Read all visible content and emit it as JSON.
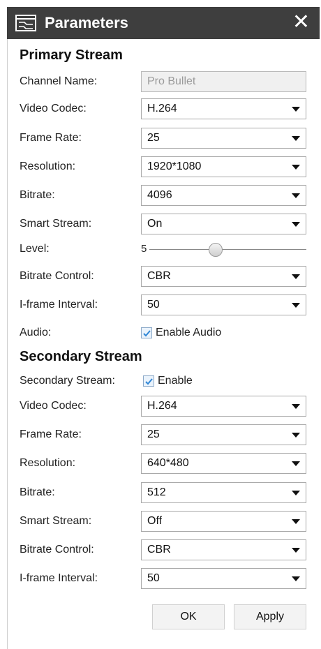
{
  "window": {
    "title": "Parameters"
  },
  "primary": {
    "section_title": "Primary Stream",
    "channel_name": {
      "label": "Channel Name:",
      "value": "Pro Bullet"
    },
    "video_codec": {
      "label": "Video Codec:",
      "value": "H.264"
    },
    "frame_rate": {
      "label": "Frame Rate:",
      "value": "25"
    },
    "resolution": {
      "label": "Resolution:",
      "value": "1920*1080"
    },
    "bitrate": {
      "label": "Bitrate:",
      "value": "4096"
    },
    "smart_stream": {
      "label": "Smart Stream:",
      "value": "On"
    },
    "level": {
      "label": "Level:",
      "value": "5"
    },
    "bitrate_control": {
      "label": "Bitrate Control:",
      "value": "CBR"
    },
    "iframe_interval": {
      "label": "I-frame Interval:",
      "value": "50"
    },
    "audio": {
      "label": "Audio:",
      "checkbox_label": "Enable Audio"
    }
  },
  "secondary": {
    "section_title": "Secondary Stream",
    "enable": {
      "label": "Secondary Stream:",
      "checkbox_label": "Enable"
    },
    "video_codec": {
      "label": "Video Codec:",
      "value": "H.264"
    },
    "frame_rate": {
      "label": "Frame Rate:",
      "value": "25"
    },
    "resolution": {
      "label": "Resolution:",
      "value": "640*480"
    },
    "bitrate": {
      "label": "Bitrate:",
      "value": "512"
    },
    "smart_stream": {
      "label": "Smart Stream:",
      "value": "Off"
    },
    "bitrate_control": {
      "label": "Bitrate Control:",
      "value": "CBR"
    },
    "iframe_interval": {
      "label": "I-frame Interval:",
      "value": "50"
    }
  },
  "buttons": {
    "ok": "OK",
    "apply": "Apply"
  },
  "icons": {
    "title": "window-icon",
    "close": "close-icon",
    "dropdown": "chevron-down-icon",
    "check": "checkmark-icon"
  },
  "colors": {
    "titlebar": "#3e3e3e",
    "checkmark": "#2f86d6"
  }
}
